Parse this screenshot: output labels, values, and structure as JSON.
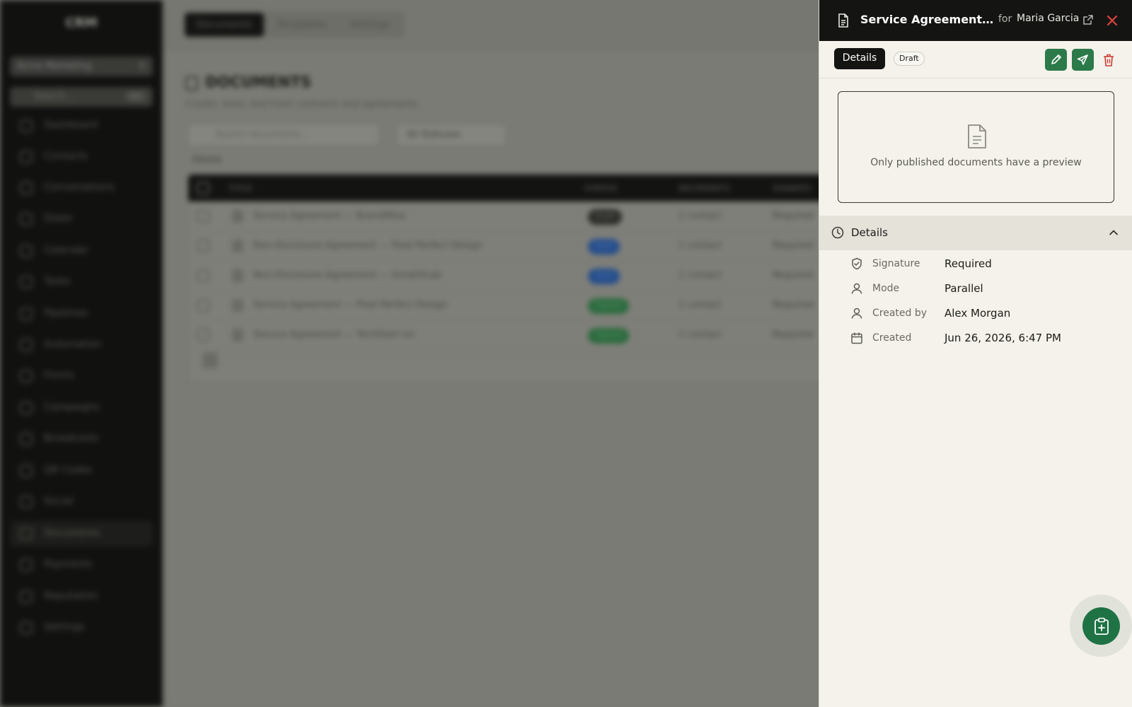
{
  "background": {
    "brand": "CRM",
    "account": "Acme Marketing",
    "sidebar_search_placeholder": "Search...",
    "sidebar_search_shortcut": "⌘K",
    "nav": [
      "Dashboard",
      "Contacts",
      "Conversations",
      "Dialer",
      "Calendar",
      "Tasks",
      "Pipelines",
      "Automation",
      "Forms",
      "Campaigns",
      "Broadcasts",
      "QR Codes",
      "Social",
      "Documents",
      "Payments",
      "Reputation",
      "Settings"
    ],
    "tabs": [
      "Documents",
      "Templates",
      "Settings"
    ],
    "page_title": "DOCUMENTS",
    "page_subtitle": "Create, send, and track contracts and agreements.",
    "doc_search_placeholder": "Search documents...",
    "status_filter": "All Statuses",
    "breadcrumb": "Home",
    "columns": [
      "TITLE",
      "STATUS",
      "RECIPIENTS",
      "SIGNATU"
    ],
    "rows": [
      {
        "title": "Service Agreement — BrandWise",
        "status": "Draft",
        "recipients": "1 contact",
        "signature": "Required"
      },
      {
        "title": "Non-Disclosure Agreement — Pixel Perfect Design",
        "status": "Sent",
        "recipients": "1 contact",
        "signature": "Required"
      },
      {
        "title": "Non-Disclosure Agreement — GrowthLab",
        "status": "Sent",
        "recipients": "1 contact",
        "signature": "Required"
      },
      {
        "title": "Service Agreement — Pixel Perfect Design",
        "status": "Signed",
        "recipients": "1 contact",
        "signature": "Required"
      },
      {
        "title": "Service Agreement — TechStart Inc",
        "status": "Signed",
        "recipients": "1 contact",
        "signature": "Required"
      }
    ]
  },
  "drawer": {
    "title": "Service Agreement — B...",
    "for_label": "for",
    "contact": "Maria Garcia",
    "tab_label": "Details",
    "status_badge": "Draft",
    "preview_message": "Only published documents have a preview",
    "section_title": "Details",
    "details": [
      {
        "label": "Signature",
        "value": "Required",
        "icon": "shield-check-icon"
      },
      {
        "label": "Mode",
        "value": "Parallel",
        "icon": "user-icon"
      },
      {
        "label": "Created by",
        "value": "Alex Morgan",
        "icon": "user-icon"
      },
      {
        "label": "Created",
        "value": "Jun 26, 2026, 6:47 PM",
        "icon": "calendar-icon"
      }
    ]
  },
  "colors": {
    "drawer_bg": "#f4f2ea",
    "header_bg": "#141413",
    "accent_green": "#2c7a4a",
    "close_red": "#d9362f",
    "trash_red": "#c93a36"
  }
}
